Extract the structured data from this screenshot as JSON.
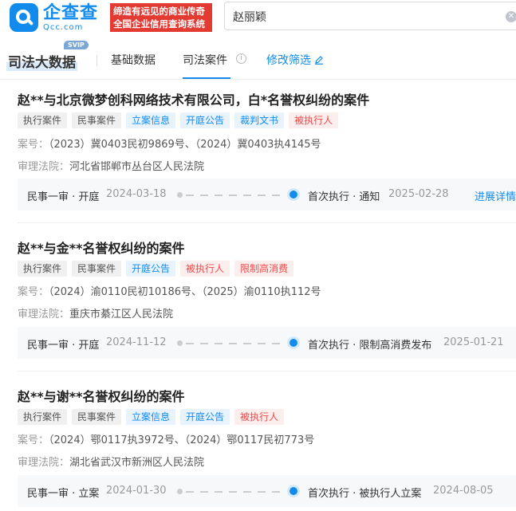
{
  "header": {
    "logo_cn": "企查查",
    "logo_en": "Qcc.com",
    "slogan_line1": "缔造有远见的商业传奇",
    "slogan_line2": "全国企业信用查询系统",
    "search_value": "赵丽颖",
    "clear_icon": "clear-icon"
  },
  "tabs": {
    "brand": "司法大数据",
    "svip": "SVIP",
    "basic": "基础数据",
    "judicial": "司法案件",
    "info": "i",
    "filter": "修改筛选"
  },
  "labels": {
    "case_no": "案号：",
    "court": "审理法院："
  },
  "cases": [
    {
      "title": "赵**与北京微梦创科网络技术有限公司，白*名誉权纠纷的案件",
      "tags": [
        {
          "text": "执行案件",
          "kind": "gray"
        },
        {
          "text": "民事案件",
          "kind": "gray"
        },
        {
          "text": "立案信息",
          "kind": "blue"
        },
        {
          "text": "开庭公告",
          "kind": "blue"
        },
        {
          "text": "裁判文书",
          "kind": "blue"
        },
        {
          "text": "被执行人",
          "kind": "red"
        }
      ],
      "case_no": "（2023）冀0403民初9869号、（2024）冀0403执4145号",
      "court": "河北省邯郸市丛台区人民法院",
      "tl_left": "民事一审 · 开庭",
      "tl_date1": "2024-03-18",
      "tl_right": "首次执行 · 通知",
      "tl_date2": "2025-02-28",
      "link": "进展详情"
    },
    {
      "title": "赵**与金**名誉权纠纷的案件",
      "tags": [
        {
          "text": "执行案件",
          "kind": "gray"
        },
        {
          "text": "民事案件",
          "kind": "gray"
        },
        {
          "text": "开庭公告",
          "kind": "blue"
        },
        {
          "text": "被执行人",
          "kind": "red"
        },
        {
          "text": "限制高消费",
          "kind": "red"
        }
      ],
      "case_no": "（2024）渝0110民初10186号、（2025）渝0110执112号",
      "court": "重庆市綦江区人民法院",
      "tl_left": "民事一审 · 开庭",
      "tl_date1": "2024-11-12",
      "tl_right": "首次执行 · 限制高消费发布",
      "tl_date2": "2025-01-21"
    },
    {
      "title": "赵**与谢**名誉权纠纷的案件",
      "tags": [
        {
          "text": "执行案件",
          "kind": "gray"
        },
        {
          "text": "民事案件",
          "kind": "gray"
        },
        {
          "text": "立案信息",
          "kind": "blue"
        },
        {
          "text": "开庭公告",
          "kind": "blue"
        },
        {
          "text": "被执行人",
          "kind": "red"
        }
      ],
      "case_no": "（2024）鄂0117执3972号、（2024）鄂0117民初773号",
      "court": "湖北省武汉市新洲区人民法院",
      "tl_left": "民事一审 · 立案",
      "tl_date1": "2024-01-30",
      "tl_right": "首次执行 · 被执行人立案",
      "tl_date2": "2024-08-05"
    }
  ],
  "colors": {
    "accent": "#128bed",
    "danger": "#ef4a4a",
    "slogan_bg": "#e33a32"
  }
}
